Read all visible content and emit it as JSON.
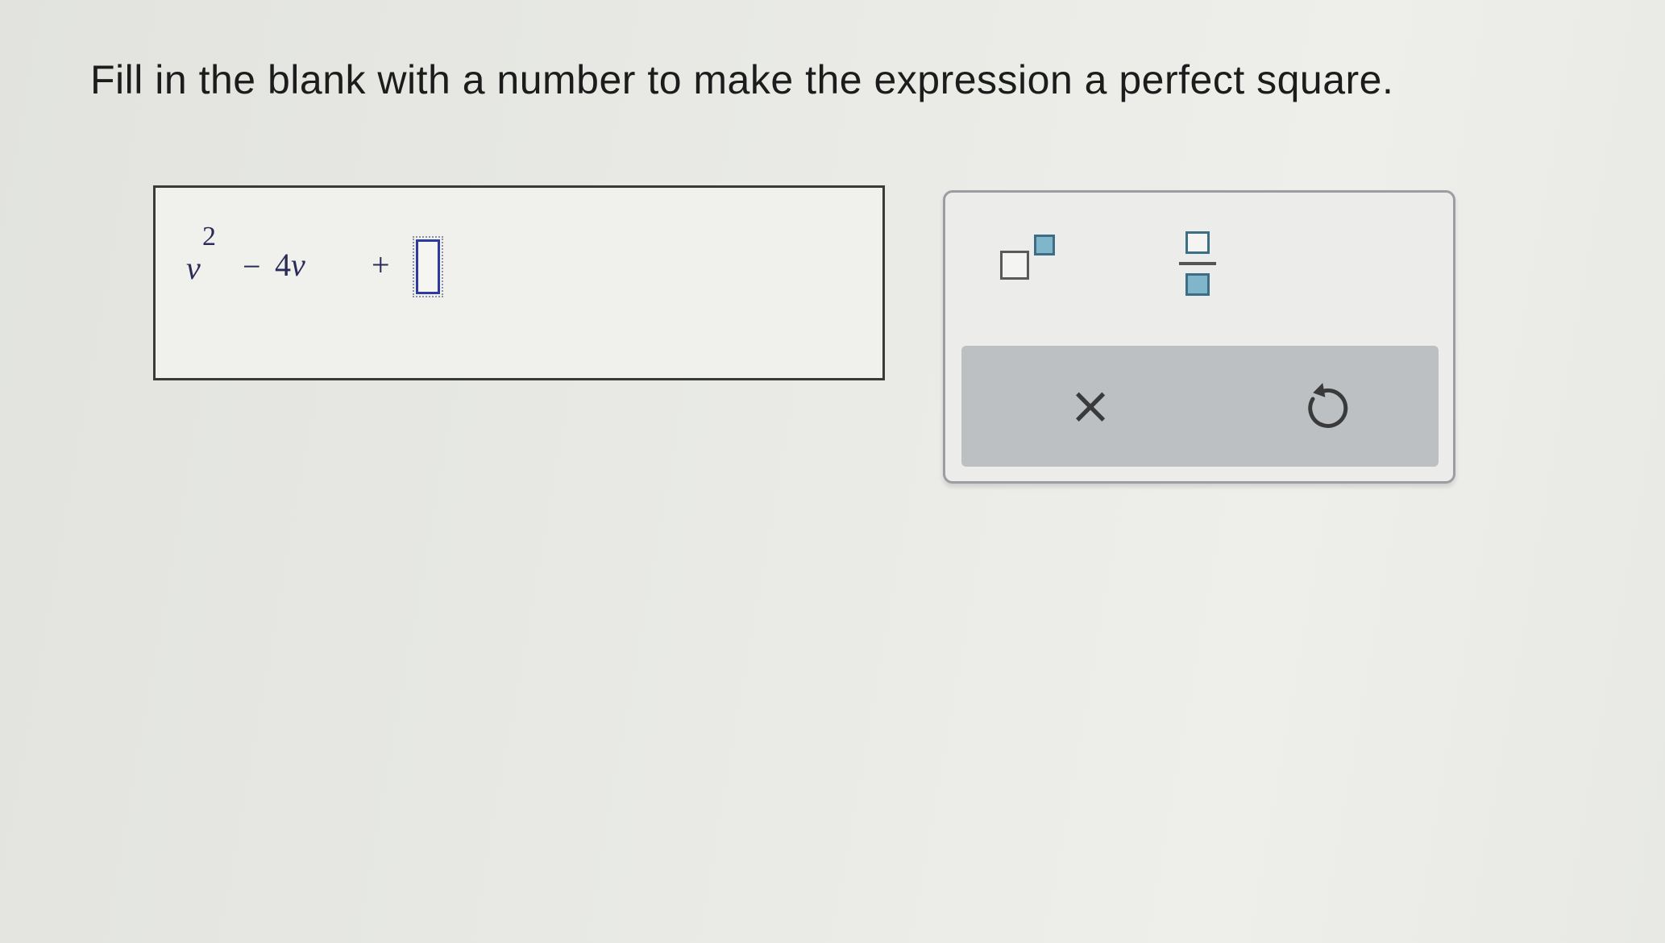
{
  "instruction": "Fill in the blank with a number to make the expression a perfect square.",
  "expression": {
    "variable": "v",
    "exponent": "2",
    "minus_sign": "−",
    "coefficient": "4",
    "coefficient_variable": "v",
    "plus_sign": "+",
    "blank_value": ""
  },
  "toolpad": {
    "exponent_icon": "superscript-template-icon",
    "fraction_icon": "fraction-template-icon",
    "clear_symbol": "×",
    "undo_icon": "undo-icon"
  },
  "colors": {
    "template_accent": "#7fb6cc",
    "blank_border": "#2f3aa0",
    "action_bar": "#bcc0c2"
  }
}
